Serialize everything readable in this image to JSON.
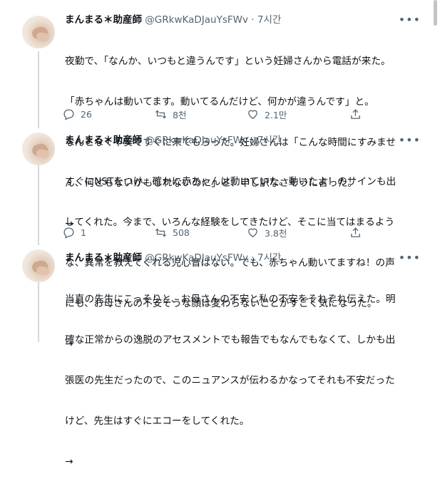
{
  "tweets": [
    {
      "name": "まんまる＊助産師",
      "handle": "@GRkwKaDJauYsFWv",
      "dot": "·",
      "time": "7시간",
      "lines": [
        "夜勤で、「なんか、いつもと違うんです」という妊婦さんから電話が来た。",
        "「赤ちゃんは動いてます。動いてるんだけど、何かが違うんです」と。",
        "なんとなく不安ですぐに来てもらった。妊婦さんは「こんな時間にすみませ",
        "ん、何ともないかもしれないのに」と、申し訳なさそうに言った。",
        "→"
      ],
      "replies": "26",
      "retweets": "8천",
      "likes": "2.1만"
    },
    {
      "name": "まんまる＊助産師",
      "handle": "@GRkwKaDJauYsFWv",
      "dot": "·",
      "time": "7시간",
      "lines": [
        "すぐにNSTをつけ、確かに赤ちゃんは動いていた。動いたよ！のサインも出",
        "してくれた。今まで、いろんな経験をしてきたけど、そこに当てはまるよう",
        "な、異常を教えてくれる児心音はない。でも、赤ちゃん動いてますね！の声",
        "にも、お母さんの不安そうな顔は変わらないことがすごく気になった。",
        "→"
      ],
      "replies": "1",
      "retweets": "508",
      "likes": "3.8천"
    },
    {
      "name": "まんまる＊助産師",
      "handle": "@GRkwKaDJauYsFWv",
      "dot": "·",
      "time": "7시간",
      "lines": [
        "当直の先生にこっそりと、お母さんの不安と私の不安をそれぞれ伝えた。明",
        "確な正常からの逸脱のアセスメントでも報告でもなんでもなくて、しかも出",
        "張医の先生だったので、このニュアンスが伝わるかなってそれも不安だった",
        "けど、先生はすぐにエコーをしてくれた。",
        "→"
      ]
    }
  ]
}
